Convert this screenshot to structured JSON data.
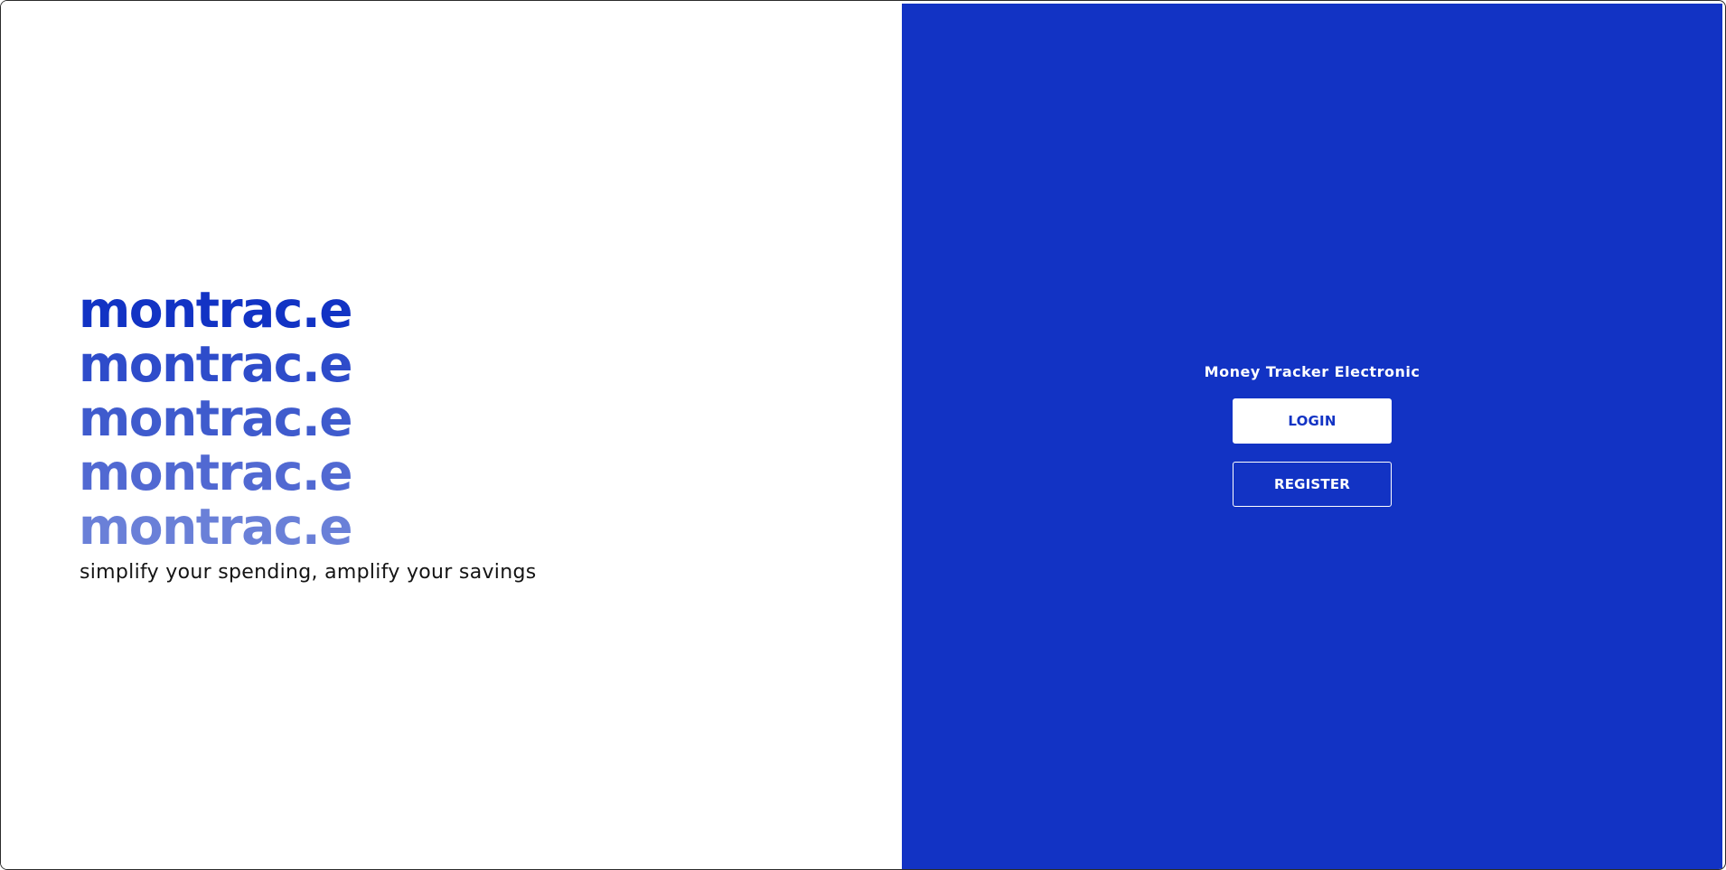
{
  "brand": {
    "wordmark_lines": [
      {
        "text": "montrac.e",
        "color": "#1233c4"
      },
      {
        "text": "montrac.e",
        "color": "#2e4cca"
      },
      {
        "text": "montrac.e",
        "color": "#3f5bcd"
      },
      {
        "text": "montrac.e",
        "color": "#5169d2"
      },
      {
        "text": "montrac.e",
        "color": "#6a80d8"
      }
    ],
    "tagline": "simplify your spending, amplify your savings"
  },
  "auth": {
    "title": "Money Tracker Electronic",
    "login_label": "LOGIN",
    "register_label": "REGISTER"
  },
  "colors": {
    "primary": "#1233c4",
    "background": "#ffffff",
    "text_dark": "#141414",
    "button_text_light": "#ffffff"
  }
}
